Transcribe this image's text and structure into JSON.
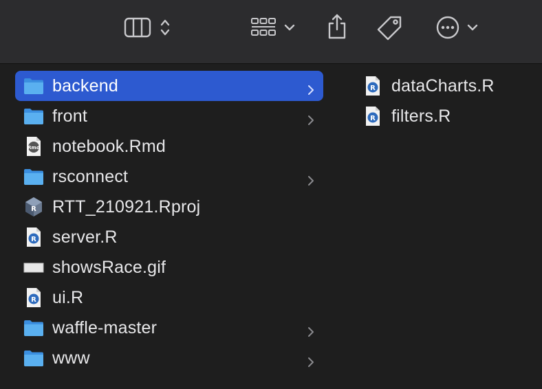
{
  "toolbar": {
    "buttons": [
      {
        "name": "view-columns",
        "icon": "columns-icon",
        "has_updown": true
      },
      {
        "name": "group",
        "icon": "grid-group-icon",
        "has_dropdown": true
      },
      {
        "name": "share",
        "icon": "share-icon"
      },
      {
        "name": "tags",
        "icon": "tag-icon"
      },
      {
        "name": "more",
        "icon": "ellipsis-circle-icon",
        "has_dropdown": true
      }
    ]
  },
  "columns": [
    {
      "items": [
        {
          "label": "backend",
          "type": "folder",
          "selected": true,
          "has_chevron": true
        },
        {
          "label": "front",
          "type": "folder",
          "has_chevron": true
        },
        {
          "label": "notebook.Rmd",
          "type": "rmd-file"
        },
        {
          "label": "rsconnect",
          "type": "folder",
          "has_chevron": true
        },
        {
          "label": "RTT_210921.Rproj",
          "type": "rproj-file"
        },
        {
          "label": "server.R",
          "type": "r-file"
        },
        {
          "label": "showsRace.gif",
          "type": "gif-file"
        },
        {
          "label": "ui.R",
          "type": "r-file"
        },
        {
          "label": "waffle-master",
          "type": "folder",
          "has_chevron": true
        },
        {
          "label": "www",
          "type": "folder",
          "has_chevron": true
        }
      ]
    },
    {
      "items": [
        {
          "label": "dataCharts.R",
          "type": "r-file"
        },
        {
          "label": "filters.R",
          "type": "r-file"
        }
      ]
    }
  ],
  "colors": {
    "selection": "#2d5ad0",
    "folder": "#4aa3e8",
    "toolbar_bg": "#2c2c2e",
    "content_bg": "#1e1e1e",
    "text": "#e8e8ea"
  }
}
